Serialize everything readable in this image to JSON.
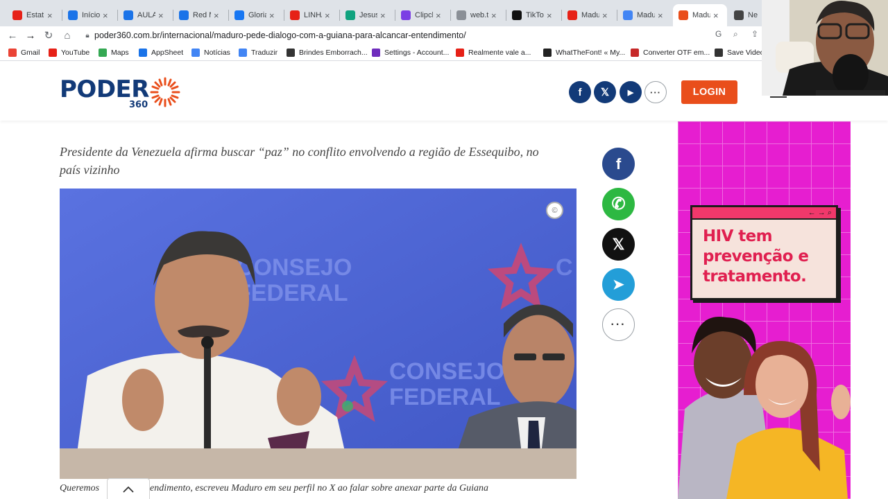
{
  "browser": {
    "tabs": [
      {
        "title": "Estatís",
        "favicon_color": "#e62117",
        "icon": "youtube-icon"
      },
      {
        "title": "Início",
        "favicon_color": "#1a73e8",
        "icon": "site-icon"
      },
      {
        "title": "AULA",
        "favicon_color": "#1a73e8",
        "icon": "site-icon"
      },
      {
        "title": "Red M",
        "favicon_color": "#1a73e8",
        "icon": "site-icon"
      },
      {
        "title": "Gloria",
        "favicon_color": "#1877f2",
        "icon": "facebook-icon"
      },
      {
        "title": "LINHA",
        "favicon_color": "#e62117",
        "icon": "youtube-icon"
      },
      {
        "title": "Jesus c",
        "favicon_color": "#10a37f",
        "icon": "chatgpt-icon"
      },
      {
        "title": "Clipch",
        "favicon_color": "#7b3fe4",
        "icon": "clipchamp-icon"
      },
      {
        "title": "web.te",
        "favicon_color": "#8a8f96",
        "icon": "telegram-icon"
      },
      {
        "title": "TikTok",
        "favicon_color": "#111111",
        "icon": "tiktok-icon"
      },
      {
        "title": "Madur",
        "favicon_color": "#e62117",
        "icon": "youtube-icon"
      },
      {
        "title": "Madur",
        "favicon_color": "#4285f4",
        "icon": "google-icon"
      },
      {
        "title": "Madu",
        "favicon_color": "#e94e1b",
        "icon": "poder360-icon"
      },
      {
        "title": "Ne",
        "favicon_color": "#444444",
        "icon": "chrome-icon"
      }
    ],
    "active_tab_index": 12,
    "url": "poder360.com.br/internacional/maduro-pede-dialogo-com-a-guiana-para-alcancar-entendimento/",
    "bookmarks": [
      {
        "label": "Gmail",
        "color": "#ea4335"
      },
      {
        "label": "YouTube",
        "color": "#e62117"
      },
      {
        "label": "Maps",
        "color": "#34a853"
      },
      {
        "label": "AppSheet",
        "color": "#1a73e8"
      },
      {
        "label": "Notícias",
        "color": "#4285f4"
      },
      {
        "label": "Traduzir",
        "color": "#4285f4"
      },
      {
        "label": "Brindes Emborrach...",
        "color": "#333333"
      },
      {
        "label": "Settings - Account...",
        "color": "#6f2dbd"
      },
      {
        "label": "Realmente vale a...",
        "color": "#e62117"
      },
      {
        "label": "WhatTheFont! « My...",
        "color": "#222222"
      },
      {
        "label": "Converter OTF em...",
        "color": "#c62828"
      },
      {
        "label": "Save Video",
        "color": "#333333"
      }
    ]
  },
  "site": {
    "logo_word": "PODER",
    "logo_number": "360",
    "brand_color": "#123a78",
    "accent_color": "#e94e1b",
    "header_social": [
      "f",
      "𝕏",
      "▶",
      "···"
    ],
    "login_label": "LOGIN"
  },
  "article": {
    "title_fragment": "entendimento",
    "subtitle": "Presidente da Venezuela afirma buscar “paz” no conflito envolvendo a região de Essequibo, no país vizinho",
    "photo_texts": {
      "left_sign": "CONSEJO\nFEDERAL",
      "bottom_sign": "CONSEJO\nFEDERAL"
    },
    "copyright_mark": "©",
    "caption_start": "Queremos",
    "caption_rest": "endimento, escreveu Maduro em seu perfil no X ao falar sobre anexar parte da Guiana",
    "share_buttons": [
      {
        "name": "facebook",
        "glyph": "f",
        "color": "#2a4a8e"
      },
      {
        "name": "whatsapp",
        "glyph": "✆",
        "color": "#2db842"
      },
      {
        "name": "x",
        "glyph": "𝕏",
        "color": "#111111"
      },
      {
        "name": "telegram",
        "glyph": "➤",
        "color": "#239ed8"
      },
      {
        "name": "more",
        "glyph": "···",
        "color": "#ffffff"
      }
    ],
    "scroll_top_glyph": "^"
  },
  "ad": {
    "headline": "HIV tem prevenção e tratamento.",
    "bar_icons": "← → ⌕",
    "background": "#e61ed0"
  }
}
